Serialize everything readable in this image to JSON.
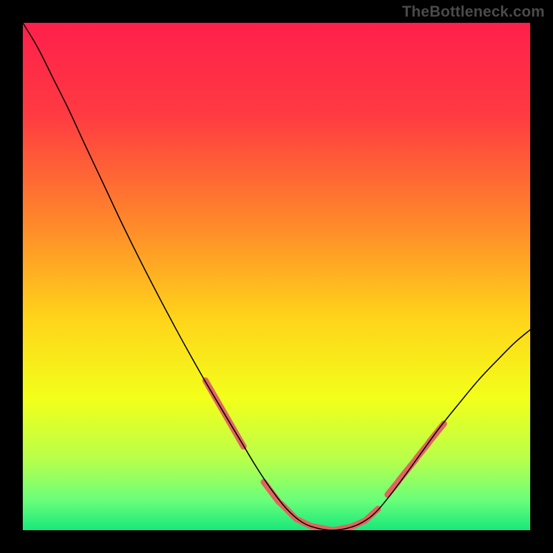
{
  "watermark": "TheBottleneck.com",
  "chart_data": {
    "type": "line",
    "title": "",
    "xlabel": "",
    "ylabel": "",
    "xlim": [
      0,
      100
    ],
    "ylim": [
      0,
      100
    ],
    "gradient_stops": [
      {
        "offset": 0.0,
        "color": "#ff1f4b"
      },
      {
        "offset": 0.18,
        "color": "#ff3a42"
      },
      {
        "offset": 0.4,
        "color": "#ff8a2a"
      },
      {
        "offset": 0.58,
        "color": "#ffd31a"
      },
      {
        "offset": 0.74,
        "color": "#f3ff1a"
      },
      {
        "offset": 0.86,
        "color": "#b8ff4a"
      },
      {
        "offset": 0.94,
        "color": "#6bff7a"
      },
      {
        "offset": 1.0,
        "color": "#17e87a"
      }
    ],
    "series": [
      {
        "name": "curve",
        "x": [
          0.0,
          3.0,
          6.0,
          9.0,
          12.0,
          16.0,
          20.0,
          25.0,
          30.0,
          35.0,
          40.0,
          43.0,
          46.0,
          49.0,
          52.0,
          55.0,
          58.0,
          61.0,
          64.0,
          67.0,
          70.0,
          74.0,
          78.0,
          82.0,
          86.0,
          90.0,
          94.0,
          97.0,
          100.0
        ],
        "y": [
          100.0,
          95.0,
          89.0,
          83.0,
          76.5,
          68.0,
          59.5,
          49.5,
          40.0,
          31.0,
          22.5,
          17.5,
          12.5,
          8.0,
          4.2,
          1.6,
          0.4,
          0.0,
          0.4,
          1.6,
          4.0,
          9.0,
          14.5,
          20.0,
          25.0,
          29.8,
          34.0,
          37.0,
          39.5
        ]
      }
    ],
    "highlight_segments": [
      {
        "x0": 36.0,
        "y0": 29.5,
        "x1": 43.5,
        "y1": 16.5
      },
      {
        "x0": 47.5,
        "y0": 9.5,
        "x1": 50.5,
        "y1": 5.5
      },
      {
        "x0": 50.8,
        "y0": 5.3,
        "x1": 53.8,
        "y1": 2.3
      },
      {
        "x0": 53.9,
        "y0": 2.2,
        "x1": 56.8,
        "y1": 0.8
      },
      {
        "x0": 56.9,
        "y0": 0.8,
        "x1": 61.0,
        "y1": 0.0
      },
      {
        "x0": 61.2,
        "y0": 0.0,
        "x1": 64.5,
        "y1": 0.6
      },
      {
        "x0": 64.6,
        "y0": 0.6,
        "x1": 67.5,
        "y1": 1.9
      },
      {
        "x0": 67.6,
        "y0": 2.0,
        "x1": 70.0,
        "y1": 4.2
      },
      {
        "x0": 71.9,
        "y0": 7.0,
        "x1": 74.0,
        "y1": 9.6
      },
      {
        "x0": 74.1,
        "y0": 9.8,
        "x1": 77.5,
        "y1": 14.0
      },
      {
        "x0": 77.6,
        "y0": 14.2,
        "x1": 80.0,
        "y1": 17.2
      },
      {
        "x0": 80.1,
        "y0": 17.4,
        "x1": 83.0,
        "y1": 21.0
      }
    ],
    "highlight_style": {
      "color": "#e0655f",
      "width": 9,
      "cap": "round"
    }
  }
}
